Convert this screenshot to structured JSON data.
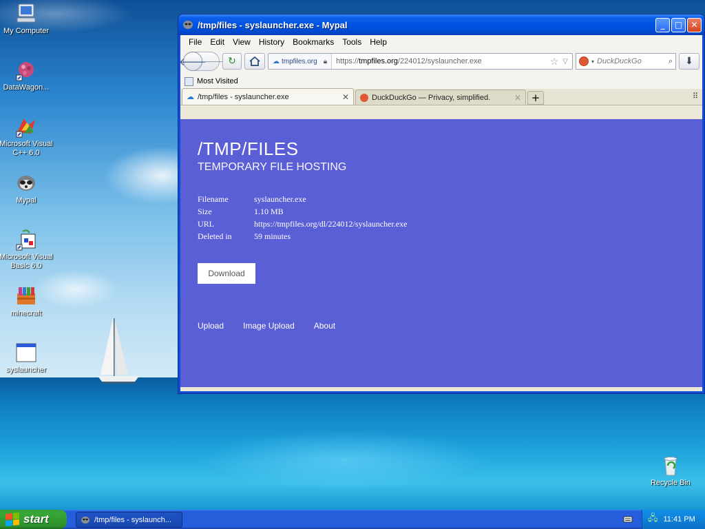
{
  "desktop": {
    "icons": [
      {
        "label": "My Computer"
      },
      {
        "label": "DataWagon..."
      },
      {
        "label": "Microsoft Visual C++ 6.0"
      },
      {
        "label": "Mypal"
      },
      {
        "label": "Microsoft Visual Basic 6.0"
      },
      {
        "label": "minecraft"
      },
      {
        "label": "syslauncher"
      },
      {
        "label": "Recycle Bin"
      }
    ]
  },
  "window": {
    "title": "/tmp/files - syslauncher.exe - Mypal",
    "buttons": {
      "minimize": "_",
      "maximize": "□",
      "close": "✕"
    }
  },
  "menubar": {
    "items": [
      "File",
      "Edit",
      "View",
      "History",
      "Bookmarks",
      "Tools",
      "Help"
    ]
  },
  "navbar": {
    "identity": "tmpfiles.org",
    "url_prefix": "https://",
    "url_host": "tmpfiles.org",
    "url_path": "/224012/syslauncher.exe",
    "search_placeholder": "DuckDuckGo"
  },
  "bookmarks": {
    "most_visited": "Most Visited"
  },
  "tabs": [
    {
      "label": "/tmp/files - syslauncher.exe",
      "active": true
    },
    {
      "label": "DuckDuckGo — Privacy, simplified.",
      "active": false
    }
  ],
  "page": {
    "title": "/TMP/FILES",
    "subtitle": "TEMPORARY FILE HOSTING",
    "info": [
      {
        "key": "Filename",
        "value": "syslauncher.exe"
      },
      {
        "key": "Size",
        "value": "1.10 MB"
      },
      {
        "key": "URL",
        "value": "https://tmpfiles.org/dl/224012/syslauncher.exe"
      },
      {
        "key": "Deleted in",
        "value": "59 minutes"
      }
    ],
    "download_label": "Download",
    "footer_links": [
      "Upload",
      "Image Upload",
      "About"
    ]
  },
  "taskbar": {
    "start_label": "start",
    "task_label": "/tmp/files - syslaunch...",
    "clock": "11:41 PM"
  },
  "colors": {
    "page_background": "#5b5fd6",
    "titlebar": "#0054e3",
    "start_button": "#37a937"
  }
}
